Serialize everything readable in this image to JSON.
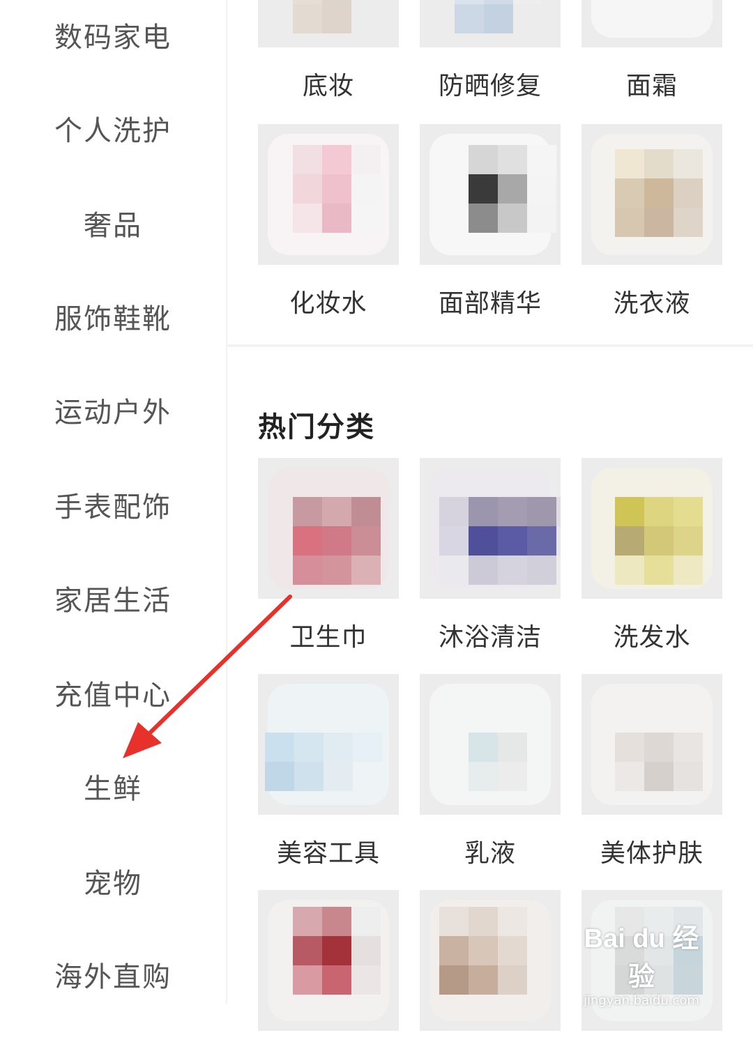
{
  "sidebar": {
    "items": [
      {
        "label": "数码家电"
      },
      {
        "label": "个人洗护"
      },
      {
        "label": "奢品"
      },
      {
        "label": "服饰鞋靴"
      },
      {
        "label": "运动户外"
      },
      {
        "label": "手表配饰"
      },
      {
        "label": "家居生活"
      },
      {
        "label": "充值中心"
      },
      {
        "label": "生鲜"
      },
      {
        "label": "宠物"
      },
      {
        "label": "海外直购"
      }
    ]
  },
  "top_grid": {
    "tiles": [
      {
        "label": "底妆"
      },
      {
        "label": "防晒修复"
      },
      {
        "label": "面霜"
      },
      {
        "label": "化妆水"
      },
      {
        "label": "面部精华"
      },
      {
        "label": "洗衣液"
      }
    ]
  },
  "hot": {
    "title": "热门分类",
    "tiles": [
      {
        "label": "卫生巾"
      },
      {
        "label": "沐浴清洁"
      },
      {
        "label": "洗发水"
      },
      {
        "label": "美容工具"
      },
      {
        "label": "乳液"
      },
      {
        "label": "美体护肤"
      },
      {
        "label": ""
      },
      {
        "label": ""
      },
      {
        "label": ""
      }
    ]
  },
  "annotation": {
    "arrow_color": "#e8312b"
  },
  "watermark": {
    "logo": "Bai du 经验",
    "url": "jingyan.baidu.com"
  }
}
